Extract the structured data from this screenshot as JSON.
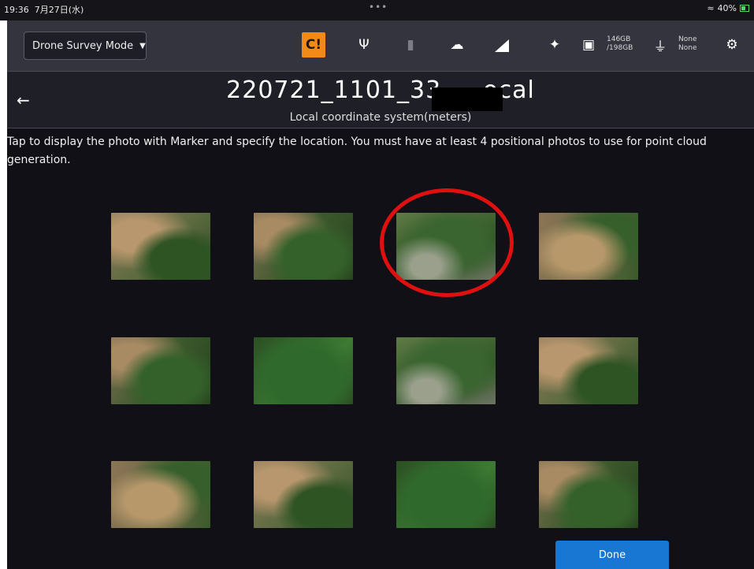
{
  "status_bar": {
    "time": "19:36",
    "date": "7月27日(水)",
    "dots": "•••",
    "battery": "40%"
  },
  "toolbar": {
    "mode": "Drone Survey Mode",
    "storage_used": "146GB",
    "storage_total": "/198GB",
    "power_line1": "None",
    "power_line2": "None",
    "icons": [
      "rtk-status-icon",
      "usb-icon",
      "sd-card-icon",
      "cloud-icon",
      "signal-icon",
      "satellite-icon",
      "folder-icon",
      "plug-icon",
      "settings-icon"
    ],
    "accent_color": "#f28a1a"
  },
  "header": {
    "title": "220721_1101_33_ _ ocal",
    "subtitle": "Local coordinate system(meters)"
  },
  "main": {
    "instruction": "Tap to display the photo with Marker and specify the location. You must have at least 4 positional photos to use for point cloud generation.",
    "photos_count": 12,
    "highlighted_photo": 3,
    "highlight_color": "#e01010",
    "done_label": "Done",
    "done_color": "#1877d2"
  }
}
